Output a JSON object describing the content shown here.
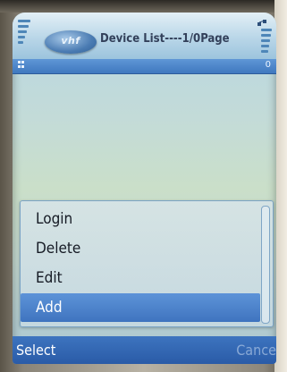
{
  "header": {
    "logo_text": "vhf",
    "title": "Device List----1/0Page"
  },
  "status": {
    "count": "0"
  },
  "menu": {
    "items": [
      {
        "label": "Login"
      },
      {
        "label": "Delete"
      },
      {
        "label": "Edit"
      },
      {
        "label": "Add"
      }
    ],
    "selected_index": 3
  },
  "softkeys": {
    "left": "Select",
    "right": "Cance"
  },
  "colors": {
    "accent": "#3f78bf",
    "selection": "#4a80c9"
  }
}
